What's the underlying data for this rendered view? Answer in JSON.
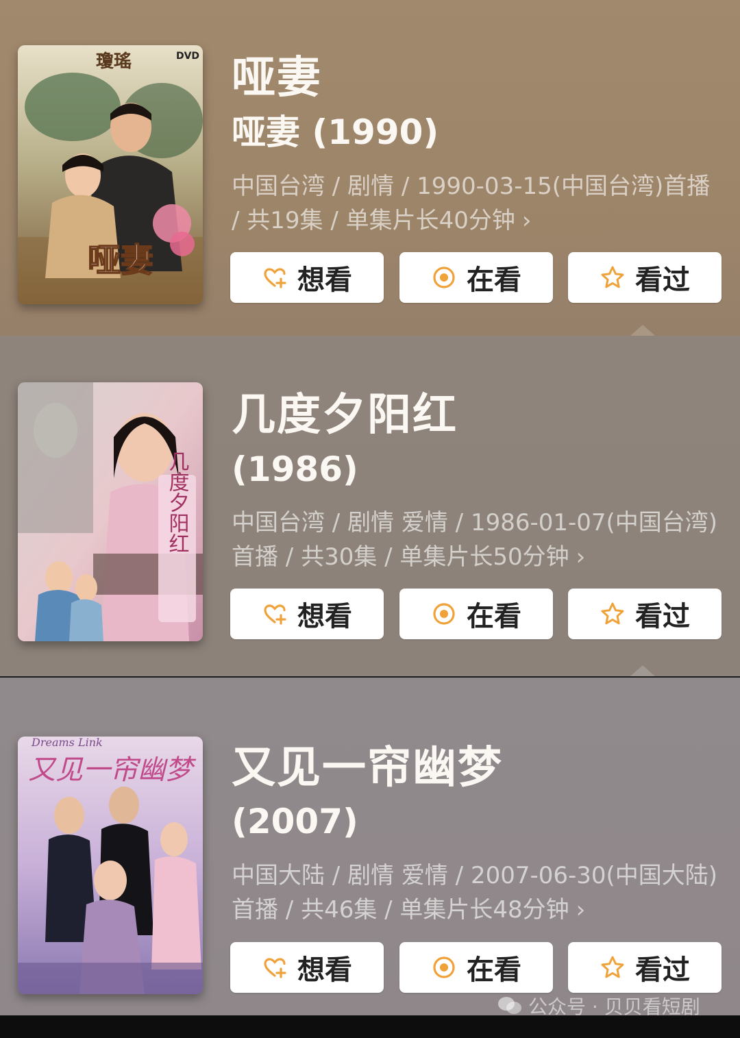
{
  "items": [
    {
      "title": "哑妻",
      "subtitle": "哑妻 (1990)",
      "meta": "中国台湾 / 剧情 / 1990-03-15(中国台湾)首播 / 共19集 / 单集片长40分钟",
      "chevron": "›",
      "poster": {
        "texts": [
          "瓊瑤",
          "DVD",
          "哑妻"
        ]
      }
    },
    {
      "title": "几度夕阳红",
      "subtitle": "(1986)",
      "meta": "中国台湾 / 剧情 爱情 / 1986-01-07(中国台湾)首播 / 共30集 / 单集片长50分钟",
      "chevron": "›",
      "poster": {
        "texts": [
          "几度夕阳红"
        ]
      }
    },
    {
      "title": "又见一帘幽梦",
      "subtitle": "(2007)",
      "meta": "中国大陆 / 剧情 爱情 / 2007-06-30(中国大陆)首播 / 共46集 / 单集片长48分钟",
      "chevron": "›",
      "poster": {
        "texts": [
          "Dreams Link",
          "又见一帘幽梦"
        ]
      }
    }
  ],
  "buttons": {
    "want": {
      "label": "想看",
      "icon": "heart-plus-icon"
    },
    "watching": {
      "label": "在看",
      "icon": "target-circle-icon"
    },
    "watched": {
      "label": "看过",
      "icon": "star-icon"
    }
  },
  "watermark": {
    "text": "公众号 · 贝贝看短剧",
    "icon": "wechat-icon"
  },
  "colors": {
    "accent": "#f0a23a",
    "title": "#fbf7f2",
    "meta": "#ffffffa0"
  }
}
